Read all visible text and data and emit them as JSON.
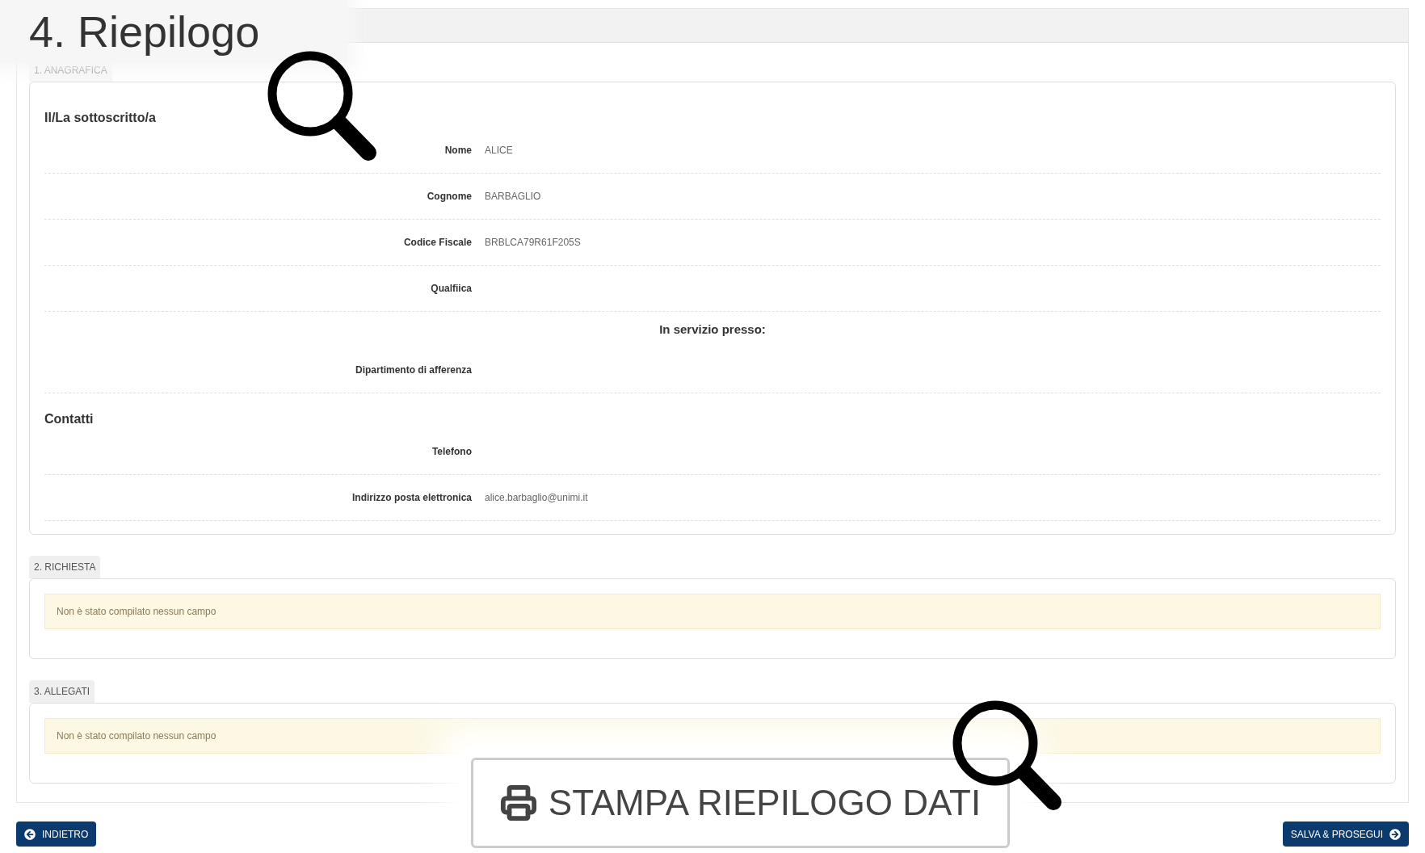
{
  "title": "4. Riepilogo",
  "sections": [
    {
      "kind": "form",
      "tab": "1. ANAGRAFICA",
      "groups": [
        {
          "heading": "Il/La sottoscritto/a",
          "rows": [
            {
              "kind": "field",
              "label": "Nome",
              "value": "ALICE"
            },
            {
              "kind": "field",
              "label": "Cognome",
              "value": "BARBAGLIO"
            },
            {
              "kind": "field",
              "label": "Codice Fiscale",
              "value": "BRBLCA79R61F205S"
            },
            {
              "kind": "field",
              "label": "Qualfiica"
            },
            {
              "kind": "subheading",
              "label": "In servizio presso:"
            },
            {
              "kind": "field",
              "label": "Dipartimento di afferenza"
            }
          ]
        },
        {
          "heading": "Contatti",
          "rows": [
            {
              "kind": "field",
              "label": "Telefono"
            },
            {
              "kind": "field",
              "label": "Indirizzo posta elettronica",
              "value": "alice.barbaglio@unimi.it"
            }
          ]
        }
      ]
    },
    {
      "kind": "notice",
      "tab": "2. RICHIESTA",
      "message": "Non è stato compilato nessun campo"
    },
    {
      "kind": "notice",
      "tab": "3. ALLEGATI",
      "message": "Non è stato compilato nessun campo"
    }
  ],
  "print_button": "STAMPA RIEPILOGO DATI",
  "back_button": "INDIETRO",
  "next_button": "SALVA & PROSEGUI"
}
